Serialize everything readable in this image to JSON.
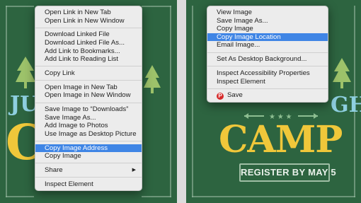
{
  "left_menu": {
    "groups": [
      [
        "Open Link in New Tab",
        "Open Link in New Window"
      ],
      [
        "Download Linked File",
        "Download Linked File As...",
        "Add Link to Bookmarks...",
        "Add Link to Reading List"
      ],
      [
        "Copy Link"
      ],
      [
        "Open Image in New Tab",
        "Open Image in New Window"
      ],
      [
        "Save Image to “Downloads”",
        "Save Image As...",
        "Add Image to Photos",
        "Use Image as Desktop Picture"
      ],
      [
        "Copy Image Address",
        "Copy Image"
      ],
      [
        "Share"
      ],
      [
        "Inspect Element"
      ]
    ],
    "highlighted": "Copy Image Address",
    "submenu_item": "Share"
  },
  "right_menu": {
    "groups": [
      [
        "View Image",
        "Save Image As...",
        "Copy Image",
        "Copy Image Location",
        "Email Image..."
      ],
      [
        "Set As Desktop Background..."
      ],
      [
        "Inspect Accessibility Properties",
        "Inspect Element"
      ],
      [
        "Save"
      ]
    ],
    "highlighted": "Copy Image Location",
    "icon_item": "Save",
    "icon": "pinterest-icon"
  },
  "poster": {
    "left_word_small": "JU",
    "left_word_big": "C",
    "right_word_small": "GH",
    "right_word_big": "CAMP",
    "banner": "REGISTER BY MAY 5"
  },
  "colors": {
    "poster_bg": "#2d6440",
    "accent_yellow": "#f0c73a",
    "highlight": "#3f85e5"
  }
}
